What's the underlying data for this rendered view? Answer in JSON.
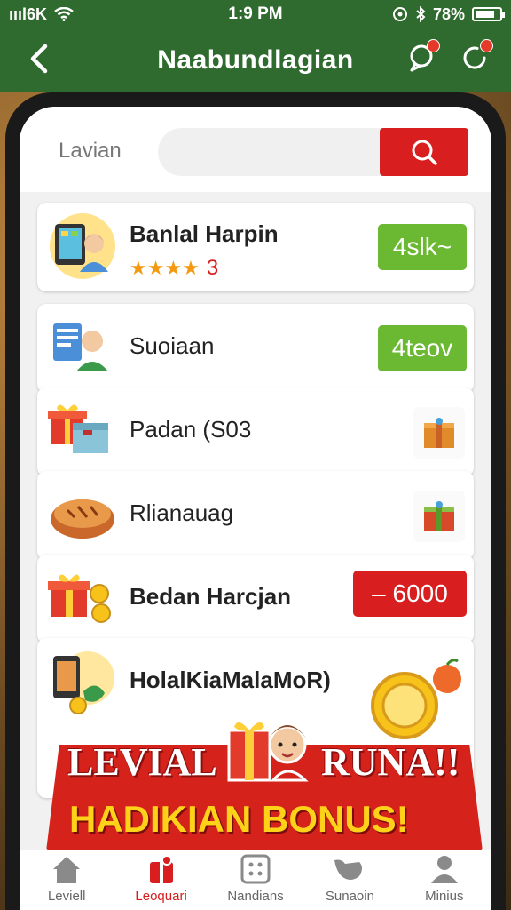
{
  "status": {
    "carrier": "ıııl6K",
    "time": "1:9 PM",
    "battery": "78%"
  },
  "header": {
    "title": "Naabundlagian"
  },
  "search": {
    "label": "Lavian"
  },
  "items": [
    {
      "name": "Banlal Harpin",
      "stars": "★★★★",
      "rating": "3",
      "action": "4slk~"
    },
    {
      "name": "Suoiaan",
      "action": "4teov"
    },
    {
      "name": "Padan (S03"
    },
    {
      "name": "Rlianauag"
    },
    {
      "name": "Bedan Harcjan",
      "action": "– 6000"
    },
    {
      "name": "HolalKiaMalaMoR)"
    }
  ],
  "banner": {
    "line1a": "LEVIAL",
    "line1b": "RUNA!!",
    "line2": "HADIKIAN BONUS!"
  },
  "nav": [
    {
      "label": "Leviell",
      "icon": "home-icon"
    },
    {
      "label": "Leoquari",
      "icon": "gift-icon"
    },
    {
      "label": "Nandians",
      "icon": "grid-icon"
    },
    {
      "label": "Sunaoin",
      "icon": "cart-icon"
    },
    {
      "label": "Minius",
      "icon": "user-icon"
    }
  ],
  "colors": {
    "header": "#2f6a2e",
    "accent_red": "#d81e1e",
    "accent_green": "#6bb832",
    "star": "#f39a12"
  }
}
